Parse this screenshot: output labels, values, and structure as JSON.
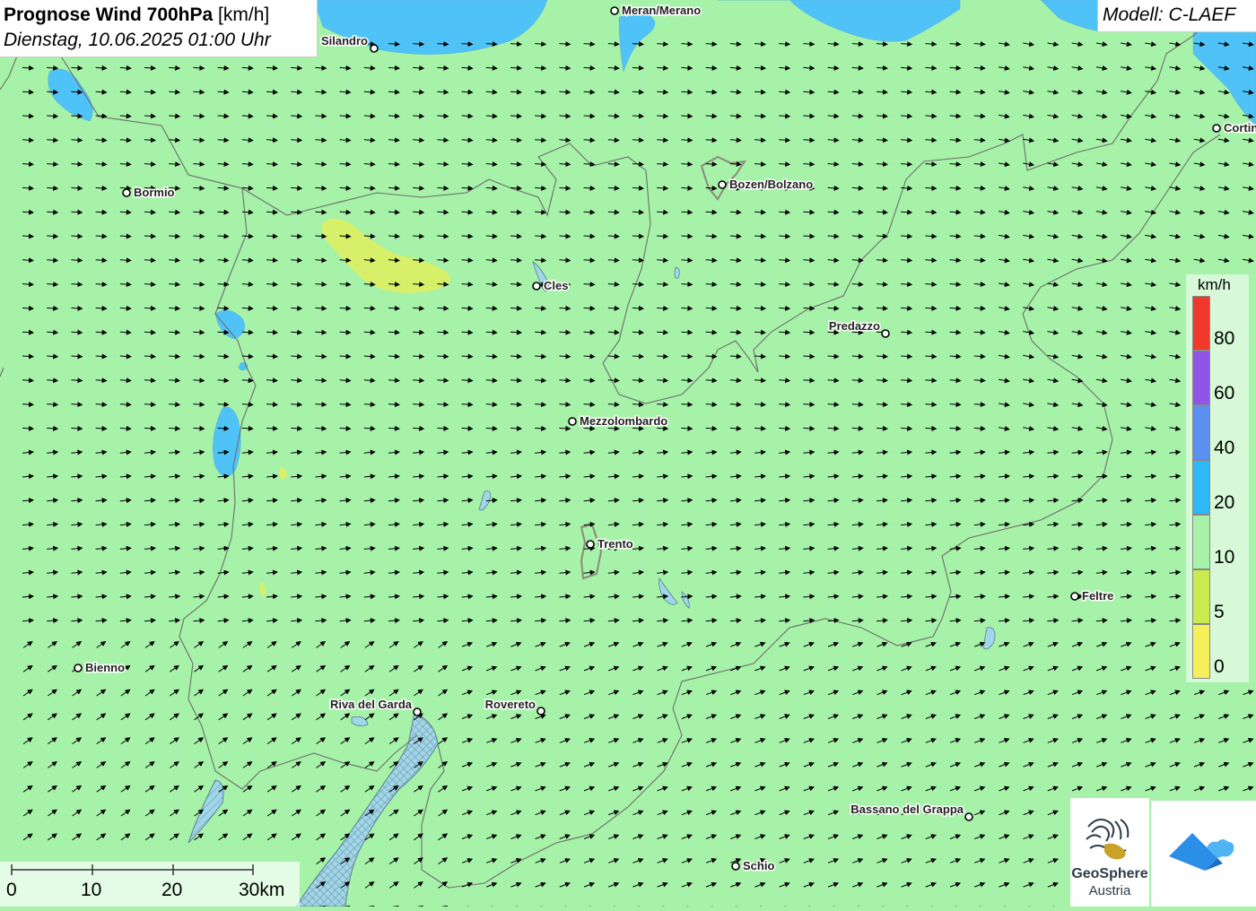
{
  "title": {
    "bold": "Prognose Wind 700hPa",
    "unit": " [km/h]",
    "datetime": "Dienstag, 10.06.2025 01:00 Uhr"
  },
  "model_label": "Modell: C-LAEF",
  "legend": {
    "unit": "km/h",
    "ticks": [
      "80",
      "60",
      "40",
      "20",
      "10",
      "5",
      "0"
    ],
    "colors": [
      "#f0392b",
      "#8e55e6",
      "#5b8ff0",
      "#2fb8f5",
      "#a6f2a8",
      "#c8ec50",
      "#f5f05a"
    ]
  },
  "cities": [
    {
      "name": "Meran/Merano",
      "id": "meran"
    },
    {
      "name": "Silandro",
      "id": "silandro"
    },
    {
      "name": "Cortina",
      "id": "cortina"
    },
    {
      "name": "Bormio",
      "id": "bormio"
    },
    {
      "name": "Bozen/Bolzano",
      "id": "bozen"
    },
    {
      "name": "Cles",
      "id": "cles"
    },
    {
      "name": "Predazzo",
      "id": "predazzo"
    },
    {
      "name": "Mezzolombardo",
      "id": "mezzolombardo"
    },
    {
      "name": "Trento",
      "id": "trento"
    },
    {
      "name": "Feltre",
      "id": "feltre"
    },
    {
      "name": "Bienno",
      "id": "bienno"
    },
    {
      "name": "Riva del Garda",
      "id": "riva"
    },
    {
      "name": "Rovereto",
      "id": "rovereto"
    },
    {
      "name": "Bassano del Grappa",
      "id": "bassano"
    },
    {
      "name": "Schio",
      "id": "schio"
    }
  ],
  "scale": {
    "labels": [
      "0",
      "10",
      "20",
      "30km"
    ]
  },
  "logo": {
    "line1": "GeoSphere",
    "line2": "Austria"
  },
  "colors": {
    "land": "#a6f2a8",
    "water": "#4fc3f7",
    "yellow_zone": "#d8ef6a",
    "arrow": "#000000"
  },
  "icons": {
    "geosphere": "geosphere-logo-icon",
    "app": "wetter-app-icon"
  }
}
